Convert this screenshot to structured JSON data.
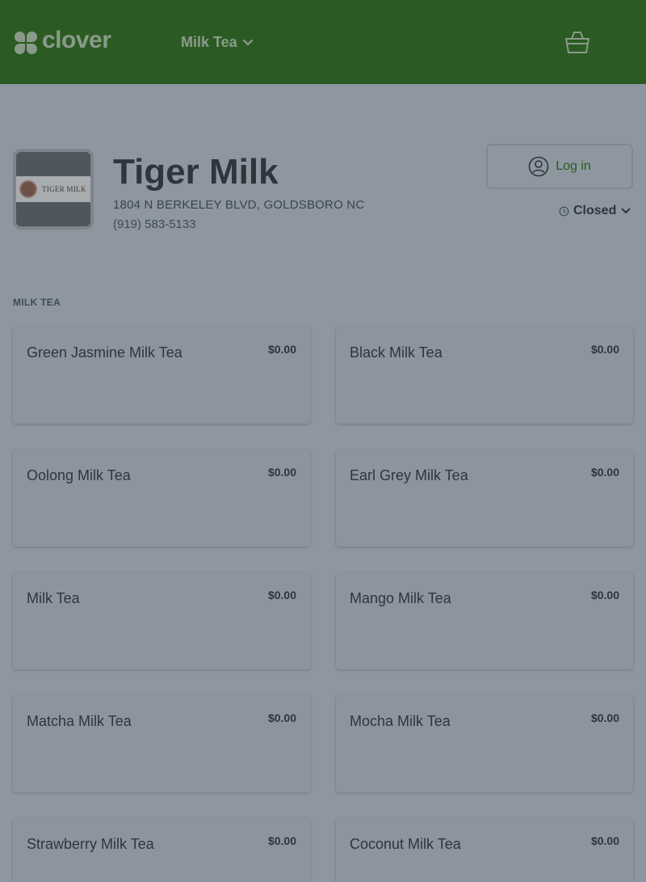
{
  "header": {
    "logo_text": "clover",
    "category_select": "Milk Tea",
    "colors": {
      "bar": "#2b5b22"
    }
  },
  "store": {
    "logo_text": "TIGER MILK",
    "name": "Tiger Milk",
    "address": "1804 N BERKELEY BLVD, GOLDSBORO NC",
    "phone": "(919) 583-5133"
  },
  "account": {
    "login_label": "Log in"
  },
  "hours": {
    "status": "Closed"
  },
  "menu": {
    "section_title": "MILK TEA",
    "items": [
      {
        "name": "Green Jasmine Milk Tea",
        "price": "$0.00"
      },
      {
        "name": "Black Milk Tea",
        "price": "$0.00"
      },
      {
        "name": "Oolong Milk Tea",
        "price": "$0.00"
      },
      {
        "name": "Earl Grey Milk Tea",
        "price": "$0.00"
      },
      {
        "name": "Milk Tea",
        "price": "$0.00"
      },
      {
        "name": "Mango Milk Tea",
        "price": "$0.00"
      },
      {
        "name": "Matcha Milk Tea",
        "price": "$0.00"
      },
      {
        "name": "Mocha Milk Tea",
        "price": "$0.00"
      },
      {
        "name": "Strawberry Milk Tea",
        "price": "$0.00"
      },
      {
        "name": "Coconut Milk Tea",
        "price": "$0.00"
      }
    ]
  }
}
